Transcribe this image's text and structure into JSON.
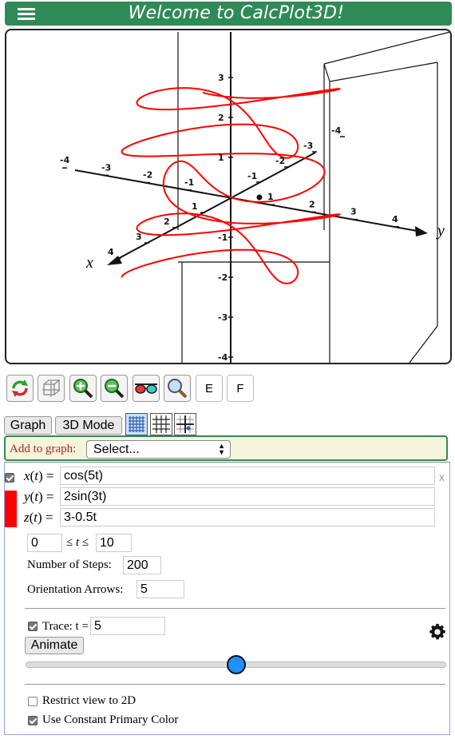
{
  "header": {
    "title": "Welcome to CalcPlot3D!",
    "menu_icon": "hamburger-icon"
  },
  "plot": {
    "axis_x_label": "x",
    "axis_y_label": "y",
    "x_ticks": [
      "-4",
      "-3",
      "-2",
      "-1",
      "1",
      "2",
      "3",
      "4"
    ],
    "y_ticks": [
      "-4",
      "-3",
      "-2",
      "-1",
      "1",
      "2",
      "3",
      "4"
    ],
    "z_ticks": [
      "3",
      "2",
      "1",
      "-1",
      "-2",
      "-3",
      "-4"
    ],
    "curve_color": "#ff0000"
  },
  "toolbar": {
    "icons": [
      "reset-view-icon",
      "box-icon",
      "zoom-in-icon",
      "zoom-out-icon",
      "3d-glasses-icon",
      "zoom-fit-icon"
    ],
    "e_label": "E",
    "f_label": "F"
  },
  "mode_row": {
    "graph_label": "Graph",
    "mode_label": "3D Mode"
  },
  "add_to_graph": {
    "label": "Add to graph:",
    "selected": "Select..."
  },
  "object": {
    "visible_checked": true,
    "color": "#ff0000",
    "x_label": "x",
    "y_label": "y",
    "z_label": "z",
    "t_var": "t",
    "eq_sign": "=",
    "x_expr": "cos(5t)",
    "y_expr": "2sin(3t)",
    "z_expr": "3-0.5t",
    "t_min": "0",
    "t_relation": "≤ t ≤",
    "t_max": "10",
    "steps_label": "Number of Steps:",
    "steps_value": "200",
    "arrows_label": "Orientation Arrows:",
    "arrows_value": "5",
    "close_label": "x"
  },
  "trace": {
    "checked": true,
    "label": "Trace: t =",
    "value": "5",
    "animate_label": "Animate",
    "slider_fraction": 0.5
  },
  "options": {
    "restrict_2d_label": "Restrict view to 2D",
    "restrict_2d_checked": false,
    "constant_color_label": "Use Constant Primary Color",
    "constant_color_checked": true
  }
}
